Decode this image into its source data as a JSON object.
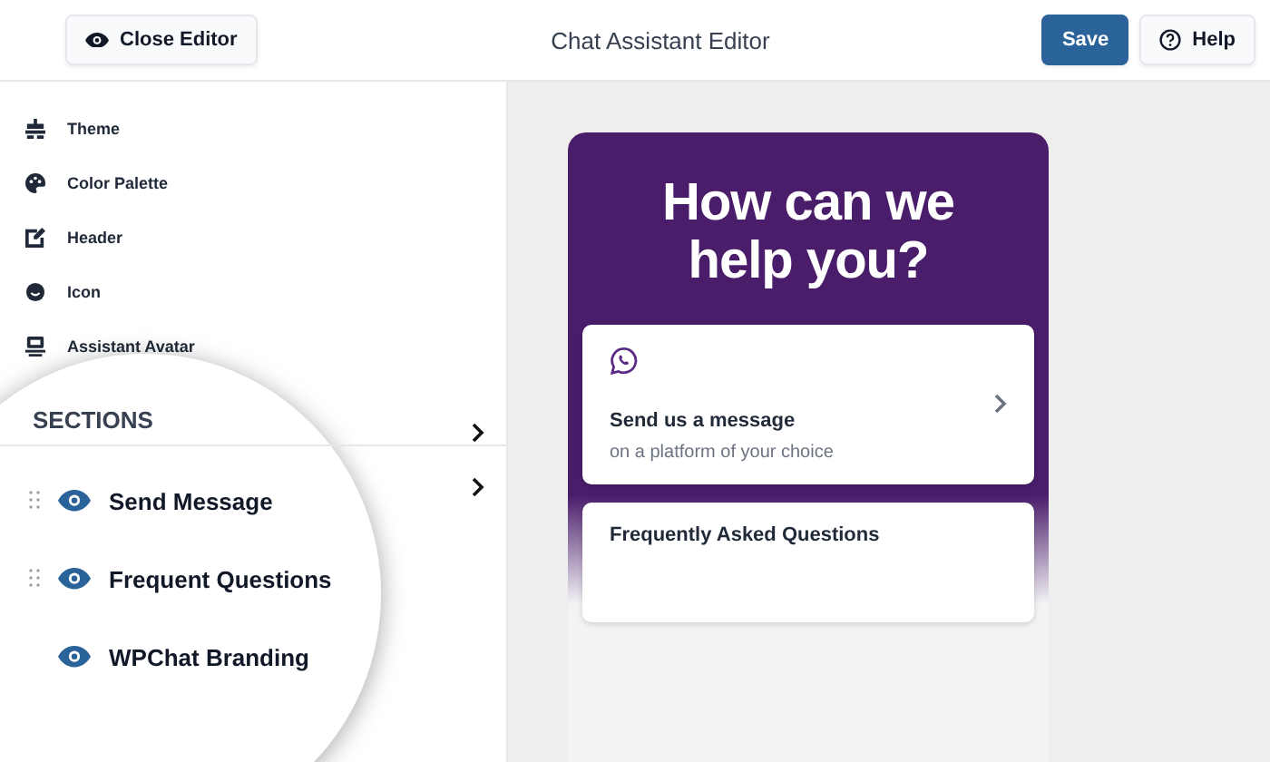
{
  "header": {
    "close_button": "Close Editor",
    "title": "Chat Assistant Editor",
    "save_button": "Save",
    "help_button": "Help"
  },
  "sidebar": {
    "items": [
      {
        "label": "Theme"
      },
      {
        "label": "Color Palette"
      },
      {
        "label": "Header"
      },
      {
        "label": "Icon"
      },
      {
        "label": "Assistant Avatar"
      }
    ]
  },
  "sections": {
    "title": "SECTIONS",
    "items": [
      {
        "label": "Send Message",
        "draggable": true,
        "visible": true,
        "chevron": true
      },
      {
        "label": "Frequent Questions",
        "draggable": true,
        "visible": true,
        "chevron": true
      },
      {
        "label": "WPChat Branding",
        "draggable": false,
        "visible": true,
        "chevron": false
      }
    ]
  },
  "preview": {
    "heading": "How can we help you?",
    "cards": [
      {
        "title": "Send us a message",
        "subtitle": "on a platform of your choice",
        "chevron": true,
        "icon": true
      },
      {
        "title": "Frequently Asked Questions",
        "chevron": false,
        "icon": false
      }
    ]
  }
}
